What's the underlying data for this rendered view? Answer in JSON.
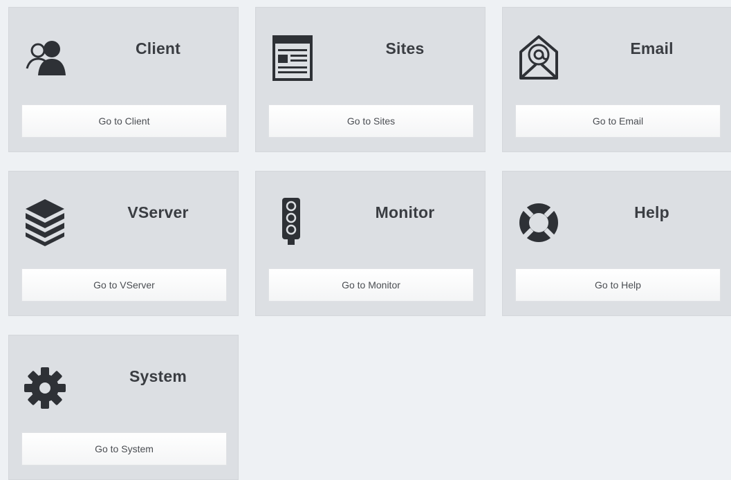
{
  "cards": [
    {
      "id": "client",
      "title": "Client",
      "button": "Go to Client",
      "icon": "users-icon"
    },
    {
      "id": "sites",
      "title": "Sites",
      "button": "Go to Sites",
      "icon": "browser-window-icon"
    },
    {
      "id": "email",
      "title": "Email",
      "button": "Go to Email",
      "icon": "envelope-at-icon"
    },
    {
      "id": "vserver",
      "title": "VServer",
      "button": "Go to VServer",
      "icon": "server-stack-icon"
    },
    {
      "id": "monitor",
      "title": "Monitor",
      "button": "Go to Monitor",
      "icon": "traffic-light-icon"
    },
    {
      "id": "help",
      "title": "Help",
      "button": "Go to Help",
      "icon": "lifebuoy-icon"
    },
    {
      "id": "system",
      "title": "System",
      "button": "Go to System",
      "icon": "gear-icon"
    }
  ],
  "colors": {
    "page_background": "#eef1f4",
    "card_background": "#dcdfe3",
    "icon": "#2e3136",
    "title": "#3a3d42"
  }
}
